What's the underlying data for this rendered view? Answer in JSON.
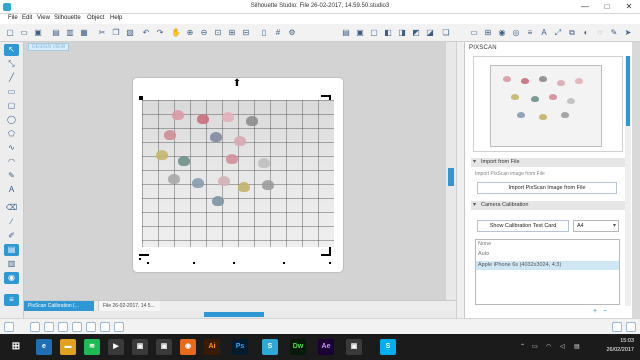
{
  "window": {
    "title": "Silhouette Studio: File 26-02-2017, 14.59.50.studio3",
    "minimize": "—",
    "maximize": "□",
    "close": "✕"
  },
  "menu": [
    "File",
    "Edit",
    "View",
    "Silhouette",
    "Object",
    "Help"
  ],
  "canvas": {
    "view_label": "DESIGN VIEW"
  },
  "tabs": [
    {
      "label": "PixScan Calibration (...",
      "active": true
    },
    {
      "label": "File 26-02-2017, 14 5...",
      "active": false
    }
  ],
  "panel": {
    "title": "PIXSCAN",
    "import_section": {
      "header": "Import from File",
      "note": "Import PixScan image from File",
      "button": "Import PixScan Image from File"
    },
    "calibration_section": {
      "header": "Camera Calibration",
      "show_button": "Show Calibration Test Card",
      "paper_size": "A4",
      "cameras": [
        {
          "label": "None",
          "selected": false
        },
        {
          "label": "Auto",
          "selected": false
        },
        {
          "label": "Apple iPhone 6s (4032x3024, 4:3)",
          "selected": true
        }
      ],
      "add": "+",
      "remove": "−"
    }
  },
  "taskbar": {
    "time": "15:03",
    "date": "26/02/2017"
  },
  "colors": {
    "accent": "#2f97d4",
    "taskbar": "#1b1b1b"
  }
}
